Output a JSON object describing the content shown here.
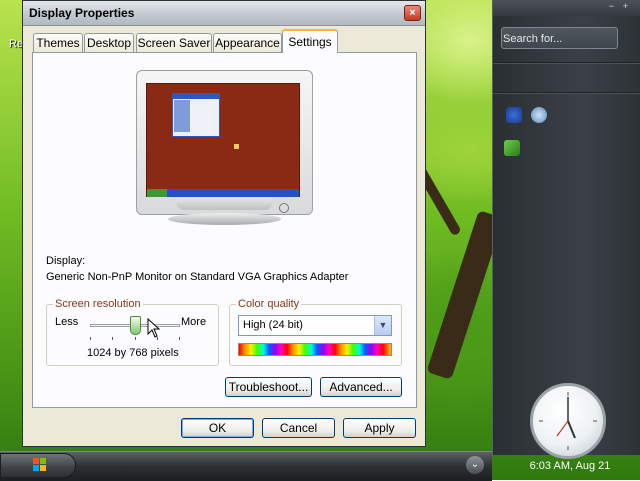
{
  "desktop": {
    "partial_icon_label": "Re"
  },
  "sidebar": {
    "search_placeholder": "Search for...",
    "clock_time": "6:03 AM, Aug 21"
  },
  "window": {
    "title": "Display Properties",
    "close_label": "×",
    "tabs": [
      {
        "label": "Themes"
      },
      {
        "label": "Desktop"
      },
      {
        "label": "Screen Saver"
      },
      {
        "label": "Appearance"
      },
      {
        "label": "Settings"
      }
    ],
    "display_label": "Display:",
    "display_value": "Generic Non-PnP Monitor on Standard VGA Graphics Adapter",
    "resolution": {
      "legend": "Screen resolution",
      "less": "Less",
      "more": "More",
      "value": "1024 by 768 pixels"
    },
    "color_quality": {
      "legend": "Color quality",
      "selected": "High (24 bit)"
    },
    "buttons": {
      "troubleshoot": "Troubleshoot...",
      "advanced": "Advanced...",
      "ok": "OK",
      "cancel": "Cancel",
      "apply": "Apply"
    }
  },
  "colors": {
    "title_accent": "#f4b53f",
    "legend_text": "#7a3b1c",
    "button_border": "#003c74",
    "monitor_wallpaper": "#8b2a14"
  }
}
